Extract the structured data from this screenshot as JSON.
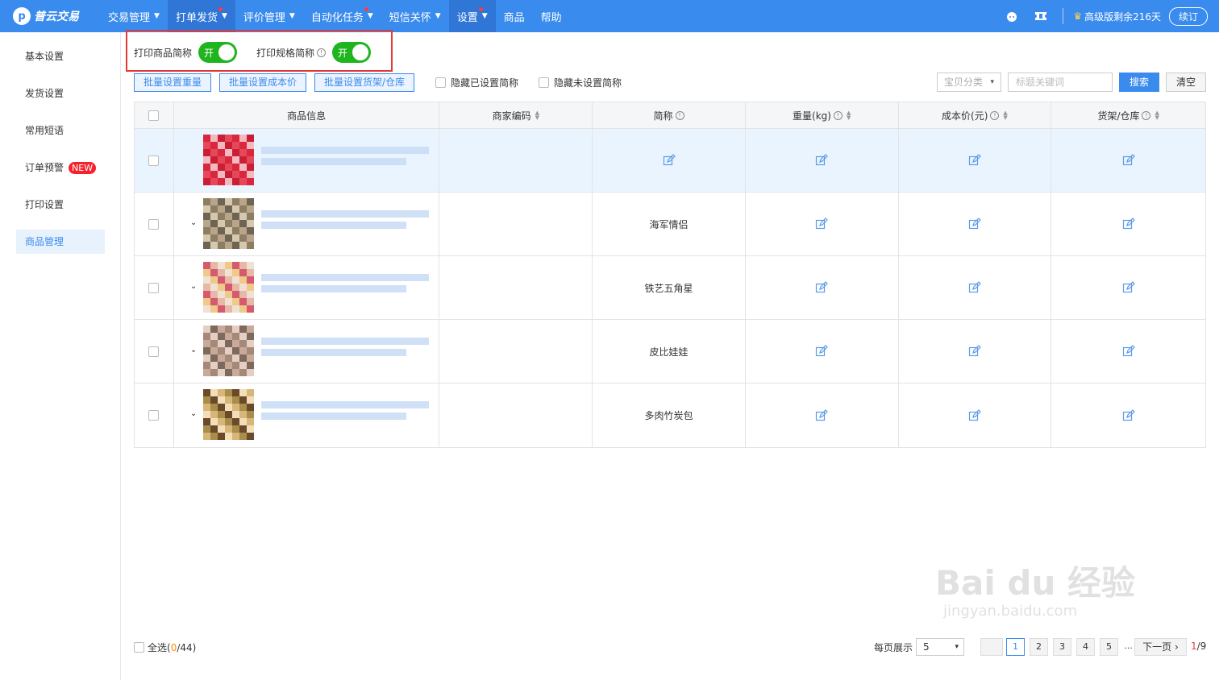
{
  "app": {
    "logo_text": "普云交易",
    "logo_glyph": "p"
  },
  "nav": [
    {
      "label": "交易管理",
      "caret": true,
      "dot": false,
      "active": false
    },
    {
      "label": "打单发货",
      "caret": true,
      "dot": true,
      "active": true
    },
    {
      "label": "评价管理",
      "caret": true,
      "dot": false,
      "active": false
    },
    {
      "label": "自动化任务",
      "caret": true,
      "dot": true,
      "active": false
    },
    {
      "label": "短信关怀",
      "caret": true,
      "dot": false,
      "active": false
    },
    {
      "label": "设置",
      "caret": true,
      "dot": true,
      "active": true
    },
    {
      "label": "商品",
      "caret": false,
      "dot": false,
      "active": false
    },
    {
      "label": "帮助",
      "caret": false,
      "dot": false,
      "active": false
    }
  ],
  "topright": {
    "version": "高级版剩余216天",
    "renew": "续订"
  },
  "sidebar": [
    {
      "label": "基本设置",
      "active": false
    },
    {
      "label": "发货设置",
      "active": false
    },
    {
      "label": "常用短语",
      "active": false
    },
    {
      "label": "订单预警",
      "active": false,
      "badge": "NEW"
    },
    {
      "label": "打印设置",
      "active": false
    },
    {
      "label": "商品管理",
      "active": true
    }
  ],
  "switches": {
    "print_name_label": "打印商品简称",
    "print_spec_label": "打印规格简称",
    "on_label": "开"
  },
  "toolbar": {
    "batch_weight": "批量设置重量",
    "batch_cost": "批量设置成本价",
    "batch_shelf": "批量设置货架/仓库",
    "hide_set": "隐藏已设置简称",
    "hide_unset": "隐藏未设置简称",
    "category_placeholder": "宝贝分类",
    "keyword_placeholder": "标题关键词",
    "search": "搜索",
    "clear": "清空"
  },
  "table": {
    "headers": [
      "商品信息",
      "商家编码",
      "简称",
      "重量(kg)",
      "成本价(元)",
      "货架/仓库"
    ],
    "rows": [
      {
        "alias": "",
        "expandable": false,
        "highlight": true
      },
      {
        "alias": "海军情侣",
        "expandable": true,
        "highlight": false
      },
      {
        "alias": "铁艺五角星",
        "expandable": true,
        "highlight": false
      },
      {
        "alias": "皮比娃娃",
        "expandable": true,
        "highlight": false
      },
      {
        "alias": "多肉竹炭包",
        "expandable": true,
        "highlight": false
      }
    ]
  },
  "footer": {
    "select_all": "全选(",
    "selected": "0",
    "total": "/44)",
    "per_page_label": "每页展示",
    "per_page_value": "5",
    "pages": [
      "1",
      "2",
      "3",
      "4",
      "5"
    ],
    "ellipsis": "...",
    "next": "下一页",
    "current_page": "1",
    "page_total": "/9"
  },
  "watermark": {
    "main": "Bai du 经验",
    "sub": "jingyan.baidu.com"
  },
  "colors": {
    "primary": "#3a8bee",
    "switch_on": "#1fb51f",
    "alert": "#e53935"
  }
}
